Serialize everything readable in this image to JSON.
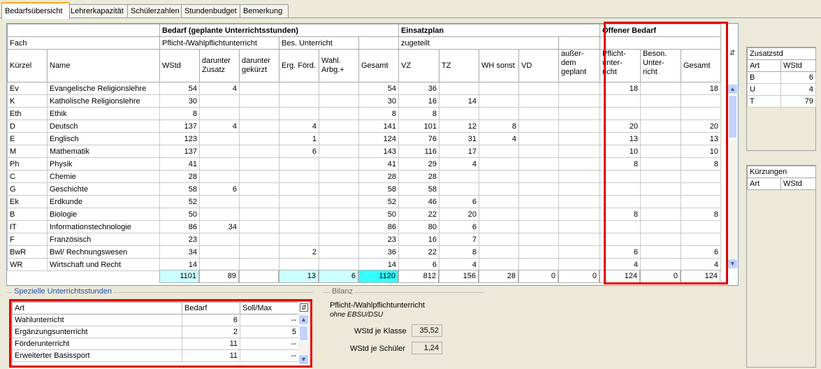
{
  "tabs": [
    "Bedarfsübersicht",
    "Lehrerkapazität",
    "Schülerzahlen",
    "Stundenbudget",
    "Bemerkung"
  ],
  "grid": {
    "groups": {
      "bedarf": "Bedarf (geplante Unterrichtsstunden)",
      "einsatz": "Einsatzplan",
      "offen": "Offener Bedarf"
    },
    "sub": {
      "fach": "Fach",
      "pflicht": "Pflicht-/Wahlpflichtunterricht",
      "bes": "Bes. Unterricht",
      "zugeteilt": "zugeteilt"
    },
    "columns": {
      "kuerzel": "Kürzel",
      "name": "Name",
      "wstd": "WStd",
      "zusatz": "darunter Zusatz",
      "gekuerzt": "darunter gekürzt",
      "ergford": "Erg. Förd.",
      "wahl": "Wahl. Arbg.+",
      "gesamt": "Gesamt",
      "vz": "VZ",
      "tz": "TZ",
      "wh": "WH sonst",
      "vd": "VD",
      "ausser": "außer- dem geplant",
      "pflu": "Pflicht- unter- richt",
      "beson": "Beson. Unter- richt",
      "ogesamt": "Gesamt"
    },
    "rows": [
      [
        "Ev",
        "Evangelische Religionslehre",
        "54",
        "4",
        "",
        "",
        "",
        "54",
        "36",
        "",
        "",
        "",
        "",
        "18",
        "",
        "18"
      ],
      [
        "K",
        "Katholische Religionslehre",
        "30",
        "",
        "",
        "",
        "",
        "30",
        "16",
        "14",
        "",
        "",
        "",
        "",
        "",
        ""
      ],
      [
        "Eth",
        "Ethik",
        "8",
        "",
        "",
        "",
        "",
        "8",
        "8",
        "",
        "",
        "",
        "",
        "",
        "",
        ""
      ],
      [
        "D",
        "Deutsch",
        "137",
        "4",
        "",
        "4",
        "",
        "141",
        "101",
        "12",
        "8",
        "",
        "",
        "20",
        "",
        "20"
      ],
      [
        "E",
        "Englisch",
        "123",
        "",
        "",
        "1",
        "",
        "124",
        "76",
        "31",
        "4",
        "",
        "",
        "13",
        "",
        "13"
      ],
      [
        "M",
        "Mathematik",
        "137",
        "",
        "",
        "6",
        "",
        "143",
        "116",
        "17",
        "",
        "",
        "",
        "10",
        "",
        "10"
      ],
      [
        "Ph",
        "Physik",
        "41",
        "",
        "",
        "",
        "",
        "41",
        "29",
        "4",
        "",
        "",
        "",
        "8",
        "",
        "8"
      ],
      [
        "C",
        "Chemie",
        "28",
        "",
        "",
        "",
        "",
        "28",
        "28",
        "",
        "",
        "",
        "",
        "",
        "",
        ""
      ],
      [
        "G",
        "Geschichte",
        "58",
        "6",
        "",
        "",
        "",
        "58",
        "58",
        "",
        "",
        "",
        "",
        "",
        "",
        ""
      ],
      [
        "Ek",
        "Erdkunde",
        "52",
        "",
        "",
        "",
        "",
        "52",
        "46",
        "6",
        "",
        "",
        "",
        "",
        "",
        ""
      ],
      [
        "B",
        "Biologie",
        "50",
        "",
        "",
        "",
        "",
        "50",
        "22",
        "20",
        "",
        "",
        "",
        "8",
        "",
        "8"
      ],
      [
        "IT",
        "Informationstechnologie",
        "86",
        "34",
        "",
        "",
        "",
        "86",
        "80",
        "6",
        "",
        "",
        "",
        "",
        "",
        ""
      ],
      [
        "F",
        "Französisch",
        "23",
        "",
        "",
        "",
        "",
        "23",
        "16",
        "7",
        "",
        "",
        "",
        "",
        "",
        ""
      ],
      [
        "BwR",
        "Bwl/ Rechnungswesen",
        "34",
        "",
        "",
        "2",
        "",
        "36",
        "22",
        "8",
        "",
        "",
        "",
        "6",
        "",
        "6"
      ],
      [
        "WR",
        "Wirtschaft und Recht",
        "14",
        "",
        "",
        "",
        "",
        "14",
        "6",
        "4",
        "",
        "",
        "",
        "4",
        "",
        "4"
      ]
    ],
    "totals": [
      "1101",
      "89",
      "",
      "13",
      "6",
      "1120",
      "812",
      "156",
      "28",
      "0",
      "0",
      "124",
      "0",
      "124"
    ]
  },
  "zusatz": {
    "title": "Zusatzstd",
    "head": [
      "Art",
      "WStd"
    ],
    "rows": [
      [
        "B",
        "6"
      ],
      [
        "U",
        "4"
      ],
      [
        "T",
        "79"
      ]
    ]
  },
  "kuerz": {
    "title": "Kürzungen",
    "head": [
      "Art",
      "WStd"
    ]
  },
  "spezielle": {
    "title": "Spezielle Unterrichtsstunden",
    "head": [
      "Art",
      "Bedarf",
      "Soll/Max"
    ],
    "rows": [
      [
        "Wahlunterricht",
        "6",
        "--"
      ],
      [
        "Ergänzungsunterricht",
        "2",
        "5"
      ],
      [
        "Förderunterricht",
        "11",
        "--"
      ],
      [
        "Erweiterter Basissport",
        "11",
        "--"
      ]
    ]
  },
  "bilanz": {
    "title": "Bilanz",
    "line1": "Pflicht-/Wahlpflichtunterricht",
    "line2": "ohne EBSU/DSU",
    "klasse_label": "WStd je Klasse",
    "klasse_value": "35,52",
    "schueler_label": "WStd je Schüler",
    "schueler_value": "1,24"
  }
}
